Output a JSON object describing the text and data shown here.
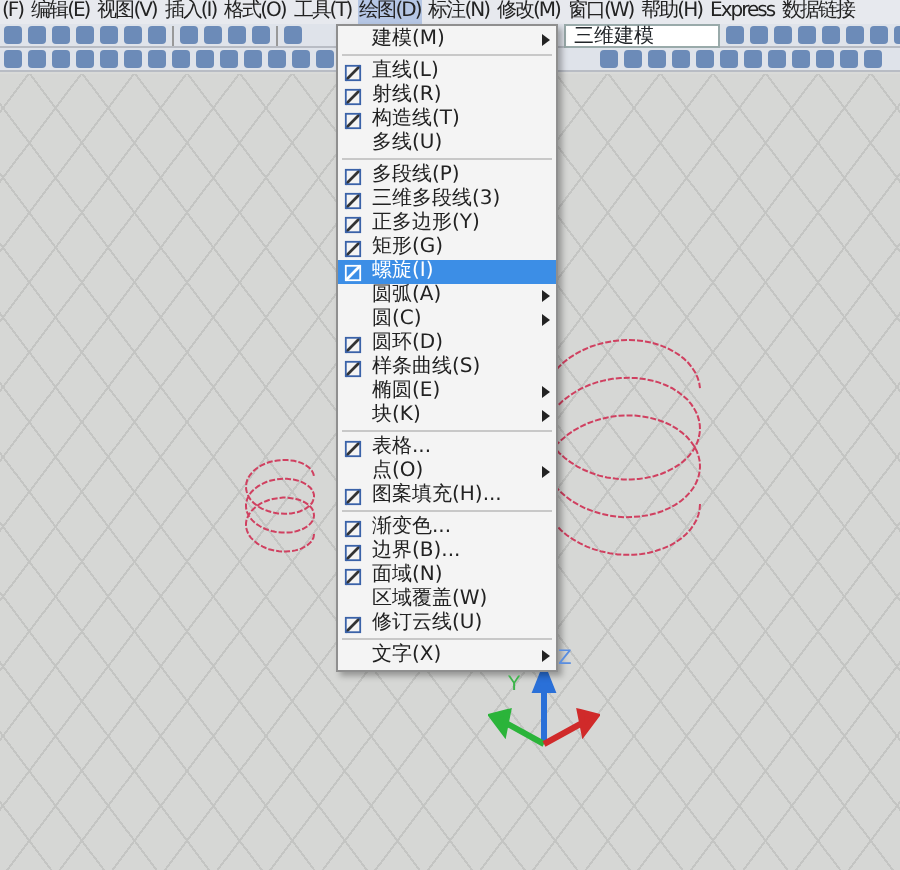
{
  "menu_bar": [
    {
      "label": "(F)",
      "selected": false
    },
    {
      "label": "编辑(E)",
      "selected": false
    },
    {
      "label": "视图(V)",
      "selected": false
    },
    {
      "label": "插入(I)",
      "selected": false
    },
    {
      "label": "格式(O)",
      "selected": false
    },
    {
      "label": "工具(T)",
      "selected": false
    },
    {
      "label": "绘图(D)",
      "selected": true
    },
    {
      "label": "标注(N)",
      "selected": false
    },
    {
      "label": "修改(M)",
      "selected": false
    },
    {
      "label": "窗口(W)",
      "selected": false
    },
    {
      "label": "帮助(H)",
      "selected": false
    },
    {
      "label": "Express",
      "selected": false
    },
    {
      "label": "数据链接",
      "selected": false
    }
  ],
  "workspace_dropdown": {
    "value": "三维建模"
  },
  "draw_menu": {
    "groups": [
      [
        {
          "label": "建模(M)",
          "submenu": true,
          "icon": false,
          "selected": false
        }
      ],
      [
        {
          "label": "直线(L)",
          "submenu": false,
          "icon": true,
          "selected": false
        },
        {
          "label": "射线(R)",
          "submenu": false,
          "icon": true,
          "selected": false
        },
        {
          "label": "构造线(T)",
          "submenu": false,
          "icon": true,
          "selected": false
        },
        {
          "label": "多线(U)",
          "submenu": false,
          "icon": false,
          "selected": false
        }
      ],
      [
        {
          "label": "多段线(P)",
          "submenu": false,
          "icon": true,
          "selected": false
        },
        {
          "label": "三维多段线(3)",
          "submenu": false,
          "icon": true,
          "selected": false
        },
        {
          "label": "正多边形(Y)",
          "submenu": false,
          "icon": true,
          "selected": false
        },
        {
          "label": "矩形(G)",
          "submenu": false,
          "icon": true,
          "selected": false
        },
        {
          "label": "螺旋(I)",
          "submenu": false,
          "icon": true,
          "selected": true
        },
        {
          "label": "圆弧(A)",
          "submenu": true,
          "icon": false,
          "selected": false
        },
        {
          "label": "圆(C)",
          "submenu": true,
          "icon": false,
          "selected": false
        },
        {
          "label": "圆环(D)",
          "submenu": false,
          "icon": true,
          "selected": false
        },
        {
          "label": "样条曲线(S)",
          "submenu": false,
          "icon": true,
          "selected": false
        },
        {
          "label": "椭圆(E)",
          "submenu": true,
          "icon": false,
          "selected": false
        },
        {
          "label": "块(K)",
          "submenu": true,
          "icon": false,
          "selected": false
        }
      ],
      [
        {
          "label": "表格...",
          "submenu": false,
          "icon": true,
          "selected": false
        },
        {
          "label": "点(O)",
          "submenu": true,
          "icon": false,
          "selected": false
        },
        {
          "label": "图案填充(H)...",
          "submenu": false,
          "icon": true,
          "selected": false
        }
      ],
      [
        {
          "label": "渐变色...",
          "submenu": false,
          "icon": true,
          "selected": false
        },
        {
          "label": "边界(B)...",
          "submenu": false,
          "icon": true,
          "selected": false
        },
        {
          "label": "面域(N)",
          "submenu": false,
          "icon": true,
          "selected": false
        },
        {
          "label": "区域覆盖(W)",
          "submenu": false,
          "icon": false,
          "selected": false
        },
        {
          "label": "修订云线(U)",
          "submenu": false,
          "icon": true,
          "selected": false
        }
      ],
      [
        {
          "label": "文字(X)",
          "submenu": true,
          "icon": false,
          "selected": false
        }
      ]
    ]
  },
  "ucs_icon": {
    "z_label": "Z",
    "y_label": "Y"
  }
}
